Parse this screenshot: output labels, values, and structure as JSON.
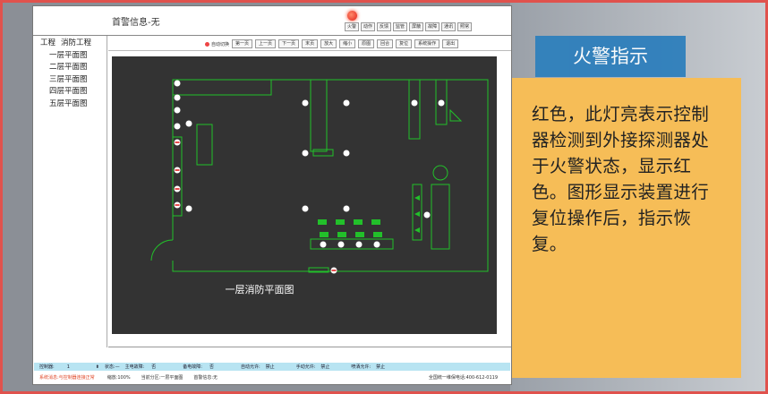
{
  "header": {
    "title": "首警信息-无",
    "buttons": [
      "火警",
      "动作",
      "反馈",
      "监管",
      "屏蔽",
      "故障",
      "通讯",
      "照常"
    ]
  },
  "tree": {
    "root_labels": [
      "工程",
      "消防工程"
    ],
    "floors": [
      "一层平面图",
      "二层平面图",
      "三层平面图",
      "四层平面图",
      "五层平面图"
    ]
  },
  "toolbar": {
    "auto_switch": "自动切换",
    "buttons": [
      "第一页",
      "上一页",
      "下一页",
      "末页",
      "放大",
      "缩小",
      "原图",
      "回合",
      "复位",
      "系统操作",
      "退出"
    ]
  },
  "plan": {
    "caption": "一层消防平面图",
    "line_color": "#22c02a",
    "bg_color": "#333333"
  },
  "statusbar": {
    "controller_label": "控制器:",
    "controller_value": "1",
    "state": "状态:—",
    "main_power": "主电故障:",
    "main_power_value": "否",
    "backup_power": "备电故障:",
    "backup_power_value": "否",
    "auto_allow": "自动允许:",
    "auto_allow_value": "禁止",
    "manual_allow": "手动允许:",
    "manual_allow_value": "禁止",
    "spray_allow": "喷洒允许:",
    "spray_allow_value": "禁止"
  },
  "infobar": {
    "system_msg": "系统消息:与控制器连接正常",
    "zoom": "缩放:100%",
    "zone": "当前分区:一层平面图",
    "first_alarm": "首警信息:无",
    "hotline": "全国统一维保电话:400-612-0119"
  },
  "callout": {
    "title": "火警指示",
    "body": "红色，此灯亮表示控制器检测到外接探测器处于火警状态，显示红色。图形显示装置进行复位操作后，指示恢复。"
  },
  "colors": {
    "frame_accent": "#e0524d",
    "callout_title_bg": "#2e7fbc",
    "callout_body_bg": "#f6bd57",
    "status_bg": "#b8e4f2"
  }
}
